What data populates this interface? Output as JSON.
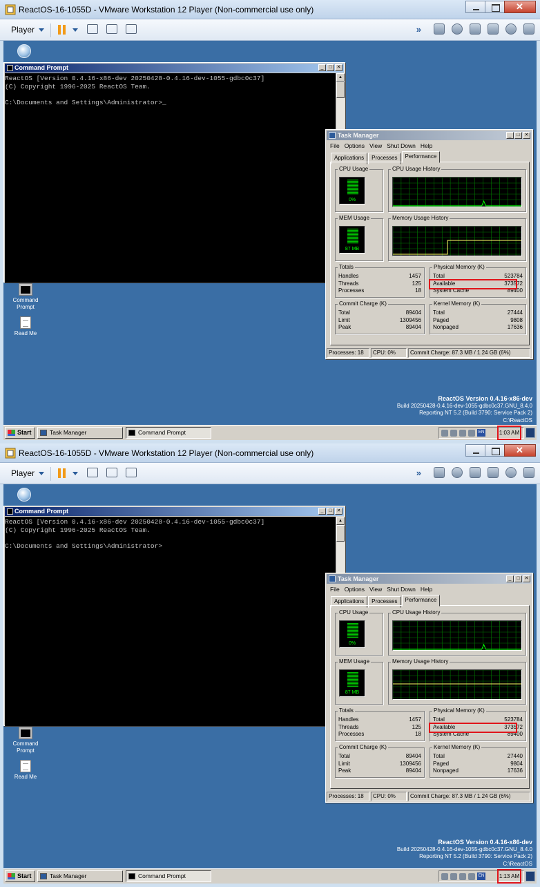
{
  "colors": {
    "desktop": "#3a6ea5",
    "highlight": "#e0141a",
    "graph": "#00c000"
  },
  "vm": {
    "window_title": "ReactOS-16-1055D - VMware Workstation 12 Player (Non-commercial use only)",
    "player_menu": "Player",
    "icons": {
      "app": "vmware-app-icon",
      "pause": "pause-icon",
      "send_keys": "send-ctrl-alt-del-icon",
      "fullscreen": "fullscreen-icon",
      "unity": "unity-icon",
      "more": "double-chevron-icon"
    }
  },
  "desktop": {
    "icons": [
      {
        "label": "Command Prompt",
        "icon": "command-prompt-icon"
      },
      {
        "label": "Read Me",
        "icon": "readme-icon"
      }
    ],
    "brand": {
      "line1": "ReactOS Version 0.4.16-x86-dev",
      "line2": "Build 20250428-0.4.16-dev-1055-gdbc0c37.GNU_8.4.0",
      "line3": "Reporting NT 5.2 (Build 3790: Service Pack 2)",
      "line4": "C:\\ReactOS"
    }
  },
  "cmd": {
    "title": "Command Prompt",
    "text1": "ReactOS [Version 0.4.16-x86-dev 20250428-0.4.16-dev-1055-gdbc0c37]\n(C) Copyright 1996-2025 ReactOS Team.\n\nC:\\Documents and Settings\\Administrator>_",
    "text2": "ReactOS [Version 0.4.16-x86-dev 20250428-0.4.16-dev-1055-gdbc0c37]\n(C) Copyright 1996-2025 ReactOS Team.\n\nC:\\Documents and Settings\\Administrator>"
  },
  "taskmgr": {
    "title": "Task Manager",
    "menu": [
      "File",
      "Options",
      "View",
      "Shut Down",
      "Help"
    ],
    "tabs": [
      "Applications",
      "Processes",
      "Performance"
    ],
    "cpu_usage_label": "CPU Usage",
    "cpu_value": "0%",
    "cpu_fraction": 0.0,
    "cpu_history_label": "CPU Usage History",
    "mem_usage_label": "MEM Usage",
    "mem_value": "87 MB",
    "mem_history_label": "Memory Usage History",
    "totals": {
      "label": "Totals",
      "rows": [
        [
          "Handles",
          "1457"
        ],
        [
          "Threads",
          "125"
        ],
        [
          "Processes",
          "18"
        ]
      ]
    },
    "physical": {
      "label": "Physical Memory (K)",
      "rows": [
        [
          "Total",
          "523784"
        ],
        [
          "Available",
          "373572"
        ],
        [
          "System Cache",
          "89400"
        ]
      ]
    },
    "commit": {
      "label": "Commit Charge (K)",
      "rows": [
        [
          "Total",
          "89404"
        ],
        [
          "Limit",
          "1309456"
        ],
        [
          "Peak",
          "89404"
        ]
      ]
    },
    "kernel1": {
      "label": "Kernel Memory (K)",
      "rows": [
        [
          "Total",
          "27444"
        ],
        [
          "Paged",
          "9808"
        ],
        [
          "Nonpaged",
          "17636"
        ]
      ]
    },
    "kernel2": {
      "label": "Kernel Memory (K)",
      "rows": [
        [
          "Total",
          "27440"
        ],
        [
          "Paged",
          "9804"
        ],
        [
          "Nonpaged",
          "17636"
        ]
      ]
    },
    "status": {
      "processes": "Processes: 18",
      "cpu": "CPU:  0%",
      "commit": "Commit Charge: 87.3 MB / 1.24 GB (6%)"
    }
  },
  "taskbar": {
    "start": "Start",
    "task_manager": "Task Manager",
    "command_prompt": "Command Prompt",
    "lang": "EN",
    "clock1": "1:03 AM",
    "clock2": "1:13 AM"
  }
}
